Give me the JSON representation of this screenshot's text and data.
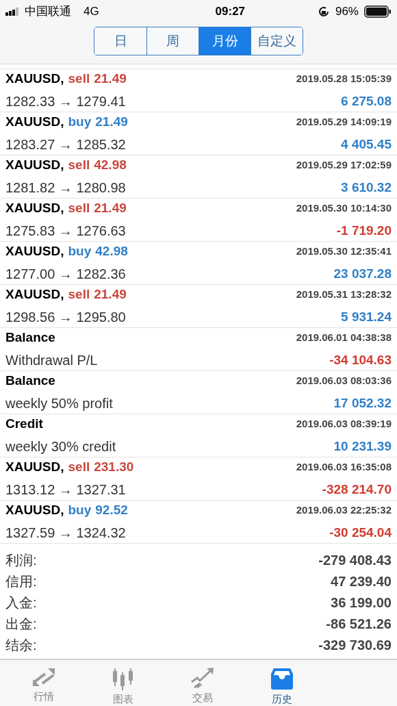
{
  "status_bar": {
    "carrier": "中国联通",
    "network": "4G",
    "time": "09:27",
    "battery": "96%"
  },
  "tabs": [
    {
      "label": "日",
      "selected": false
    },
    {
      "label": "周",
      "selected": false
    },
    {
      "label": "月份",
      "selected": true
    },
    {
      "label": "自定义",
      "selected": false
    }
  ],
  "rows": [
    {
      "kind": "trade",
      "symbol": "XAUUSD,",
      "side": "sell",
      "volume": "21.49",
      "prices": "1282.33 → 1279.41",
      "time": "2019.05.28 15:05:39",
      "profit": "6 275.08",
      "loss": false
    },
    {
      "kind": "trade",
      "symbol": "XAUUSD,",
      "side": "buy",
      "volume": "21.49",
      "prices": "1283.27 → 1285.32",
      "time": "2019.05.29 14:09:19",
      "profit": "4 405.45",
      "loss": false
    },
    {
      "kind": "trade",
      "symbol": "XAUUSD,",
      "side": "sell",
      "volume": "42.98",
      "prices": "1281.82 → 1280.98",
      "time": "2019.05.29 17:02:59",
      "profit": "3 610.32",
      "loss": false
    },
    {
      "kind": "trade",
      "symbol": "XAUUSD,",
      "side": "sell",
      "volume": "21.49",
      "prices": "1275.83 → 1276.63",
      "time": "2019.05.30 10:14:30",
      "profit": "-1 719.20",
      "loss": true
    },
    {
      "kind": "trade",
      "symbol": "XAUUSD,",
      "side": "buy",
      "volume": "42.98",
      "prices": "1277.00 → 1282.36",
      "time": "2019.05.30 12:35:41",
      "profit": "23 037.28",
      "loss": false
    },
    {
      "kind": "trade",
      "symbol": "XAUUSD,",
      "side": "sell",
      "volume": "21.49",
      "prices": "1298.56 → 1295.80",
      "time": "2019.05.31 13:28:32",
      "profit": "5 931.24",
      "loss": false
    },
    {
      "kind": "operation",
      "title": "Balance",
      "comment": "Withdrawal P/L",
      "time": "2019.06.01 04:38:38",
      "profit": "-34 104.63",
      "loss": true
    },
    {
      "kind": "operation",
      "title": "Balance",
      "comment": "weekly 50% profit",
      "time": "2019.06.03 08:03:36",
      "profit": "17 052.32",
      "loss": false
    },
    {
      "kind": "operation",
      "title": "Credit",
      "comment": "weekly 30% credit",
      "time": "2019.06.03 08:39:19",
      "profit": "10 231.39",
      "loss": false
    },
    {
      "kind": "trade",
      "symbol": "XAUUSD,",
      "side": "sell",
      "volume": "231.30",
      "prices": "1313.12 → 1327.31",
      "time": "2019.06.03 16:35:08",
      "profit": "-328 214.70",
      "loss": true
    },
    {
      "kind": "trade",
      "symbol": "XAUUSD,",
      "side": "buy",
      "volume": "92.52",
      "prices": "1327.59 → 1324.32",
      "time": "2019.06.03 22:25:32",
      "profit": "-30 254.04",
      "loss": true
    }
  ],
  "summary": [
    {
      "label": "利润:",
      "value": "-279 408.43"
    },
    {
      "label": "信用:",
      "value": "47 239.40"
    },
    {
      "label": "入金:",
      "value": "36 199.00"
    },
    {
      "label": "出金:",
      "value": "-86 521.26"
    },
    {
      "label": "结余:",
      "value": "-329 730.69"
    }
  ],
  "tab_bar": [
    {
      "kind": "quotes",
      "label": "行情",
      "selected": false
    },
    {
      "kind": "chart",
      "label": "图表",
      "selected": false
    },
    {
      "kind": "trade",
      "label": "交易",
      "selected": false
    },
    {
      "kind": "history",
      "label": "历史",
      "selected": true
    }
  ]
}
